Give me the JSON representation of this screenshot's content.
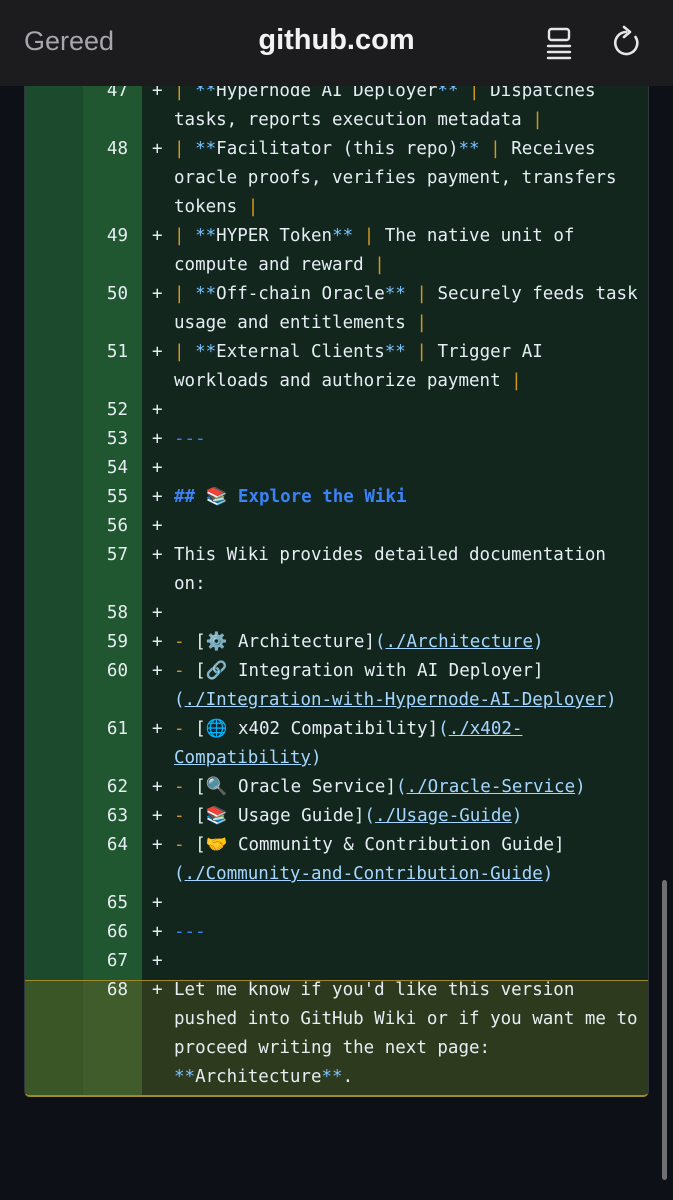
{
  "browser": {
    "done_label": "Gereed",
    "domain": "github.com",
    "reader_icon": "reader-icon",
    "reload_icon": "reload-icon"
  },
  "diff": {
    "lines": [
      {
        "num": "47",
        "parts": [
          [
            "pipe",
            "| "
          ],
          [
            "star",
            "**"
          ],
          [
            "t",
            "Hypernode AI Deployer"
          ],
          [
            "star",
            "**"
          ],
          [
            "t",
            " "
          ],
          [
            "pipe",
            "|"
          ],
          [
            "t",
            " Dispatches tasks, reports execution metadata "
          ],
          [
            "pipe",
            "|"
          ]
        ]
      },
      {
        "num": "48",
        "parts": [
          [
            "pipe",
            "| "
          ],
          [
            "star",
            "**"
          ],
          [
            "t",
            "Facilitator (this repo)"
          ],
          [
            "star",
            "**"
          ],
          [
            "t",
            " "
          ],
          [
            "pipe",
            "|"
          ],
          [
            "t",
            " Receives oracle proofs, verifies payment, transfers tokens "
          ],
          [
            "pipe",
            "|"
          ]
        ]
      },
      {
        "num": "49",
        "parts": [
          [
            "pipe",
            "| "
          ],
          [
            "star",
            "**"
          ],
          [
            "t",
            "HYPER Token"
          ],
          [
            "star",
            "**"
          ],
          [
            "t",
            " "
          ],
          [
            "pipe",
            "|"
          ],
          [
            "t",
            " The native unit of compute and reward "
          ],
          [
            "pipe",
            "|"
          ]
        ]
      },
      {
        "num": "50",
        "parts": [
          [
            "pipe",
            "| "
          ],
          [
            "star",
            "**"
          ],
          [
            "t",
            "Off-chain Oracle"
          ],
          [
            "star",
            "**"
          ],
          [
            "t",
            " "
          ],
          [
            "pipe",
            "|"
          ],
          [
            "t",
            " Securely feeds task usage and entitlements "
          ],
          [
            "pipe",
            "|"
          ]
        ]
      },
      {
        "num": "51",
        "parts": [
          [
            "pipe",
            "| "
          ],
          [
            "star",
            "**"
          ],
          [
            "t",
            "External Clients"
          ],
          [
            "star",
            "**"
          ],
          [
            "t",
            " "
          ],
          [
            "pipe",
            "|"
          ],
          [
            "t",
            " Trigger AI workloads and authorize payment "
          ],
          [
            "pipe",
            "|"
          ]
        ]
      },
      {
        "num": "52",
        "parts": []
      },
      {
        "num": "53",
        "parts": [
          [
            "hr",
            "---"
          ]
        ]
      },
      {
        "num": "54",
        "parts": []
      },
      {
        "num": "55",
        "parts": [
          [
            "heading",
            "## 📚 Explore the Wiki"
          ]
        ]
      },
      {
        "num": "56",
        "parts": []
      },
      {
        "num": "57",
        "parts": [
          [
            "t",
            "This Wiki provides detailed documentation on:"
          ]
        ]
      },
      {
        "num": "58",
        "parts": []
      },
      {
        "num": "59",
        "parts": [
          [
            "dash-y",
            "- "
          ],
          [
            "brk",
            "["
          ],
          [
            "t",
            "⚙️ Architecture"
          ],
          [
            "brk",
            "]"
          ],
          [
            "par",
            "("
          ],
          [
            "link",
            "./Architecture"
          ],
          [
            "par",
            ")"
          ]
        ]
      },
      {
        "num": "60",
        "parts": [
          [
            "dash-y",
            "- "
          ],
          [
            "brk",
            "["
          ],
          [
            "t",
            "🔗 Integration with AI Deployer"
          ],
          [
            "brk",
            "]"
          ],
          [
            "par",
            "("
          ],
          [
            "link",
            "./Integration-with-Hypernode-AI-Deployer"
          ],
          [
            "par",
            ")"
          ]
        ]
      },
      {
        "num": "61",
        "parts": [
          [
            "dash-y",
            "- "
          ],
          [
            "brk",
            "["
          ],
          [
            "t",
            "🌐 x402 Compatibility"
          ],
          [
            "brk",
            "]"
          ],
          [
            "par",
            "("
          ],
          [
            "link",
            "./x402-Compatibility"
          ],
          [
            "par",
            ")"
          ]
        ]
      },
      {
        "num": "62",
        "parts": [
          [
            "dash-y",
            "- "
          ],
          [
            "brk",
            "["
          ],
          [
            "t",
            "🔍 Oracle Service"
          ],
          [
            "brk",
            "]"
          ],
          [
            "par",
            "("
          ],
          [
            "link",
            "./Oracle-Service"
          ],
          [
            "par",
            ")"
          ]
        ]
      },
      {
        "num": "63",
        "parts": [
          [
            "dash-y",
            "- "
          ],
          [
            "brk",
            "["
          ],
          [
            "t",
            "📚 Usage Guide"
          ],
          [
            "brk",
            "]"
          ],
          [
            "par",
            "("
          ],
          [
            "link",
            "./Usage-Guide"
          ],
          [
            "par",
            ")"
          ]
        ]
      },
      {
        "num": "64",
        "parts": [
          [
            "dash-y",
            "- "
          ],
          [
            "brk",
            "["
          ],
          [
            "t",
            "🤝 Community & Contribution Guide"
          ],
          [
            "brk",
            "]"
          ],
          [
            "par",
            "("
          ],
          [
            "link",
            "./Community-and-Contribution-Guide"
          ],
          [
            "par",
            ")"
          ]
        ]
      },
      {
        "num": "65",
        "parts": []
      },
      {
        "num": "66",
        "parts": [
          [
            "hr",
            "---"
          ]
        ]
      },
      {
        "num": "67",
        "parts": []
      },
      {
        "num": "68",
        "parts": [
          [
            "t",
            "Let me know if you'd like this version pushed into GitHub Wiki or if you want me to proceed writing the next page: "
          ],
          [
            "star",
            "**"
          ],
          [
            "t",
            "Architecture"
          ],
          [
            "star",
            "**"
          ],
          [
            "t",
            "."
          ]
        ]
      }
    ],
    "plus_sign": "+"
  }
}
